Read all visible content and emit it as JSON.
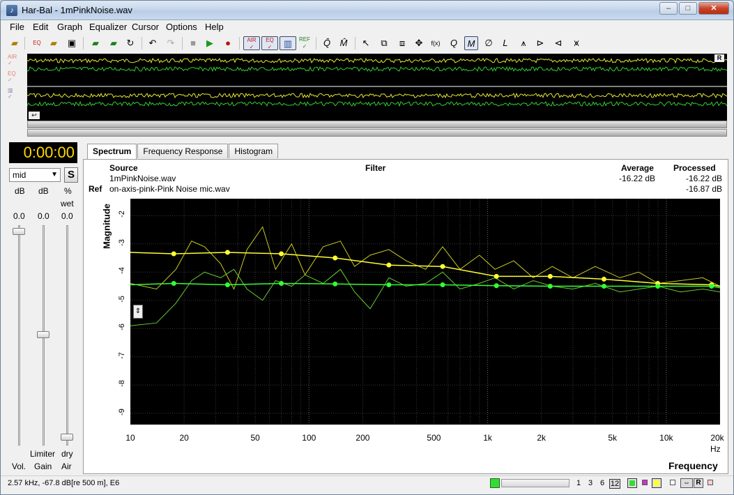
{
  "window": {
    "title": "Har-Bal - 1mPinkNoise.wav",
    "app_icon": "harbal-app-icon",
    "buttons": {
      "minimize": "‒",
      "maximize": "□",
      "close": "✕"
    }
  },
  "menu": [
    "File",
    "Edit",
    "Graph",
    "Equalizer",
    "Cursor",
    "Options",
    "Help"
  ],
  "toolbar": {
    "left_labels": {
      "eq": "EQ",
      "ref": "REF",
      "air": "AIR"
    }
  },
  "wave_side_labels": [
    "AIR",
    "EQ",
    ""
  ],
  "wave_markers": {
    "right": "R"
  },
  "transport": {
    "time": "0:00:00",
    "mode": "mid",
    "s_label": "S"
  },
  "sliders": {
    "headers": [
      "dB",
      "dB",
      "%"
    ],
    "sub_header": "wet",
    "values": [
      "0.0",
      "0.0",
      "0.0"
    ],
    "bottom_top": [
      "Limiter",
      "dry"
    ],
    "bottom_labels": [
      "Vol.",
      "Gain",
      "Air"
    ]
  },
  "tabs": [
    "Spectrum",
    "Frequency Response",
    "Histogram"
  ],
  "info": {
    "source_header": "Source",
    "filter_header": "Filter",
    "average_header": "Average",
    "processed_header": "Processed",
    "source_file": "1mPinkNoise.wav",
    "ref_label": "Ref",
    "ref_file": "on-axis-pink-Pink Noise mic.wav",
    "source_average": "-16.22 dB",
    "source_processed": "-16.22 dB",
    "ref_processed": "-16.87 dB"
  },
  "chart_data": {
    "type": "line",
    "xlabel": "Frequency",
    "x_unit": "Hz",
    "ylabel": "Magnitude",
    "x_scale": "log",
    "xlim": [
      10,
      20000
    ],
    "ylim": [
      -9.4,
      -1.4
    ],
    "x_ticks": [
      "10",
      "20",
      "50",
      "100",
      "200",
      "500",
      "1k",
      "2k",
      "5k",
      "10k",
      "20k"
    ],
    "x_tick_values": [
      10,
      20,
      50,
      100,
      200,
      500,
      1000,
      2000,
      5000,
      10000,
      20000
    ],
    "y_ticks": [
      "-2",
      "-3",
      "-4",
      "-5",
      "-6",
      "-7",
      "-8",
      "-9"
    ],
    "y_tick_values": [
      -2,
      -3,
      -4,
      -5,
      -6,
      -7,
      -8,
      -9
    ],
    "grid": true,
    "series": [
      {
        "color": "#ffff33",
        "role": "source smoothed",
        "x": [
          10,
          17.5,
          35,
          70,
          140,
          280,
          560,
          1120,
          2240,
          4480,
          8960,
          17920,
          20000
        ],
        "y": [
          -3.3,
          -3.35,
          -3.3,
          -3.35,
          -3.5,
          -3.75,
          -3.8,
          -4.15,
          -4.15,
          -4.25,
          -4.4,
          -4.45,
          -4.5
        ]
      },
      {
        "color": "#33ff33",
        "role": "ref smoothed",
        "x": [
          10,
          17.5,
          35,
          70,
          140,
          280,
          560,
          1120,
          2240,
          4480,
          8960,
          17920,
          20000
        ],
        "y": [
          -4.45,
          -4.4,
          -4.45,
          -4.4,
          -4.42,
          -4.45,
          -4.45,
          -4.48,
          -4.5,
          -4.5,
          -4.5,
          -4.5,
          -4.55
        ]
      },
      {
        "color": "#cccc22",
        "role": "source raw",
        "x": [
          10,
          14,
          18,
          22,
          26,
          32,
          38,
          45,
          55,
          65,
          80,
          95,
          120,
          150,
          180,
          220,
          280,
          350,
          450,
          560,
          700,
          900,
          1100,
          1400,
          1800,
          2300,
          3000,
          4000,
          5500,
          7000,
          9000,
          12000,
          16000,
          20000
        ],
        "y": [
          -4.4,
          -4.6,
          -3.9,
          -2.9,
          -3.1,
          -3.7,
          -4.6,
          -3.2,
          -2.4,
          -3.9,
          -3.0,
          -4.1,
          -3.1,
          -2.9,
          -3.8,
          -3.4,
          -3.2,
          -3.6,
          -3.9,
          -3.1,
          -3.9,
          -3.4,
          -3.9,
          -3.6,
          -4.2,
          -3.8,
          -4.2,
          -3.8,
          -4.2,
          -4.0,
          -4.4,
          -4.3,
          -4.2,
          -4.5
        ]
      },
      {
        "color": "#66cc33",
        "role": "ref raw",
        "x": [
          10,
          14,
          18,
          22,
          26,
          32,
          38,
          45,
          55,
          65,
          80,
          95,
          120,
          150,
          180,
          220,
          280,
          350,
          450,
          560,
          700,
          900,
          1100,
          1400,
          1800,
          2300,
          3000,
          4000,
          5500,
          7000,
          9000,
          12000,
          16000,
          20000
        ],
        "y": [
          -5.9,
          -5.8,
          -5.1,
          -4.3,
          -4.0,
          -4.2,
          -3.9,
          -4.6,
          -5.0,
          -4.3,
          -4.5,
          -4.1,
          -4.4,
          -3.9,
          -4.7,
          -5.3,
          -4.2,
          -4.5,
          -4.4,
          -4.0,
          -4.6,
          -4.4,
          -4.2,
          -4.6,
          -4.3,
          -4.5,
          -4.6,
          -4.4,
          -4.7,
          -4.6,
          -4.5,
          -4.7,
          -4.6,
          -4.7
        ]
      }
    ]
  },
  "status": {
    "readout": "2.57 kHz, -67.8 dB[re 500 m], E6",
    "numbers": [
      "1",
      "3",
      "6",
      "12"
    ],
    "marker_r": "R",
    "colors": {
      "green": "#33dd33",
      "magenta": "#cc33cc",
      "yellow": "#ffff33"
    }
  }
}
